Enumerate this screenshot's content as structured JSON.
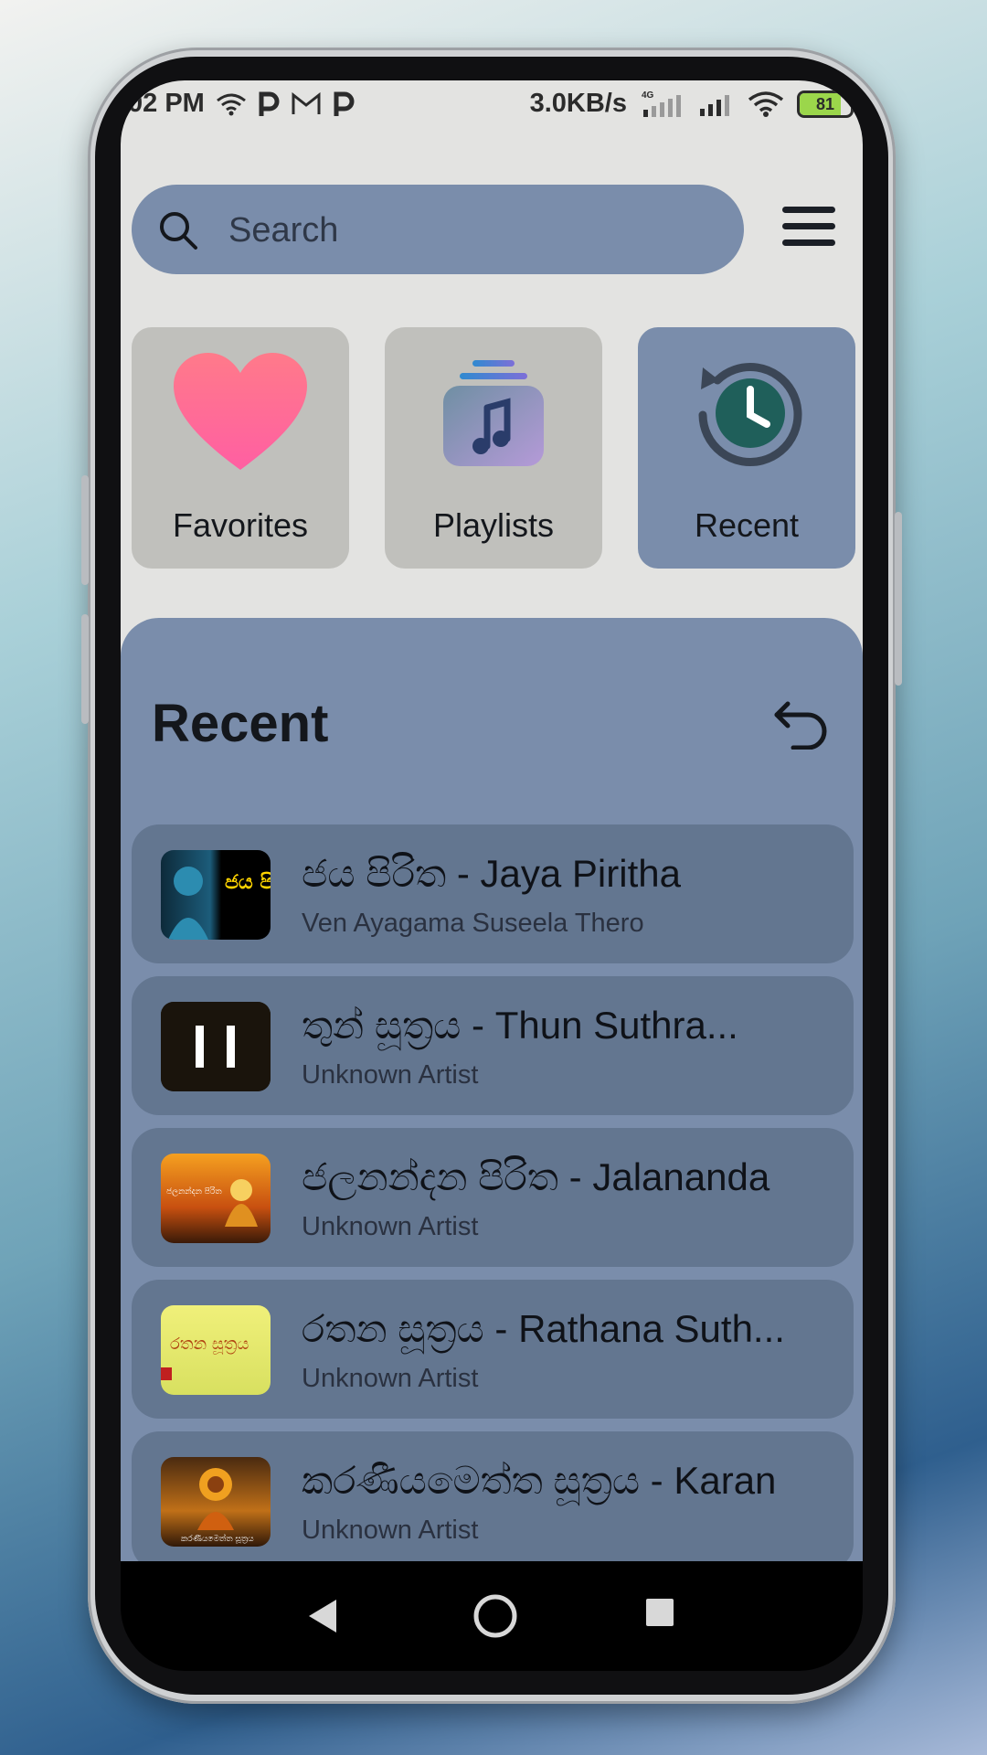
{
  "status_bar": {
    "time": "02 PM",
    "speed": "3.0KB/s",
    "network": "4G",
    "battery": "81"
  },
  "search": {
    "placeholder": "Search"
  },
  "tiles": [
    {
      "label": "Favorites",
      "icon": "heart-icon"
    },
    {
      "label": "Playlists",
      "icon": "playlist-icon"
    },
    {
      "label": "Recent",
      "icon": "history-icon"
    }
  ],
  "recent": {
    "title": "Recent",
    "tracks": [
      {
        "title": "ජය පිරිත - Jaya Piritha",
        "artist": "Ven Ayagama Suseela Thero",
        "thumb_text": "ජය පිරිත"
      },
      {
        "title": "තුන් සූත්‍රය - Thun Suthra...",
        "artist": "Unknown Artist",
        "playing": true
      },
      {
        "title": "ජලනන්දන පිරිත - Jalananda",
        "artist": "Unknown Artist",
        "thumb_text": "ජලනන්දන පිරිත"
      },
      {
        "title": "රතන සූත්‍රය - Rathana Suth...",
        "artist": "Unknown Artist",
        "thumb_text": "රතන සූත්‍රය"
      },
      {
        "title": "කරණීයමෙත්ත සූත්‍රය - Karan",
        "artist": "Unknown Artist",
        "thumb_text": "කරණීයමෙත්ත සූත්‍රය"
      }
    ]
  },
  "colors": {
    "panel": "#7a8dab",
    "card": "#637690",
    "heart": "#ff6b8f",
    "clock": "#1f5f5a"
  }
}
